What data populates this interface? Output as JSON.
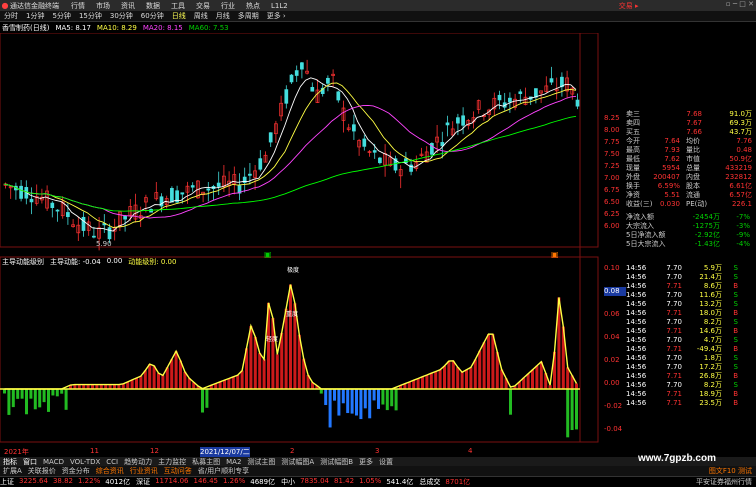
{
  "menubar": {
    "app_title": "通达信金融终端",
    "menus": [
      "行情",
      "市场",
      "资讯",
      "数据",
      "工具",
      "交易",
      "行业",
      "热点",
      "L1L2"
    ],
    "trade_label": "交易 ▸"
  },
  "toolbar": {
    "periods": [
      "分时",
      "1分钟",
      "5分钟",
      "15分钟",
      "30分钟",
      "60分钟",
      "日线",
      "周线",
      "月线",
      "多周期",
      "更多 ›"
    ],
    "active": "日线"
  },
  "ma_line": {
    "title": "香雪制药(日线)",
    "ma5": "MA5: 8.17",
    "ma10": "MA10: 8.29",
    "ma20": "MA20: 8.15",
    "ma60": "MA60: 7.53"
  },
  "price_axis": [
    "8.25",
    "8.00",
    "7.75",
    "7.50",
    "7.25",
    "7.00",
    "6.75",
    "6.50",
    "6.25",
    "6.00"
  ],
  "low_label": "5.90",
  "indicator": {
    "name": "主导动能级别",
    "label1": "主导动能: -0.04",
    "label2": "0.00",
    "label3": "动能级别: 0.00",
    "axis": [
      "0.10",
      "0.08",
      "0.06",
      "0.04",
      "0.02",
      "0.00",
      "-0.02",
      "-0.04"
    ],
    "axis_highlight": "0.08",
    "tags": [
      "轻度",
      "重度",
      "极度"
    ]
  },
  "right_panel": {
    "quotes": [
      {
        "label": "卖三",
        "price": "7.68",
        "vol": "91.0万"
      },
      {
        "label": "卖四",
        "price": "7.67",
        "vol": "69.3万"
      },
      {
        "label": "买五",
        "price": "7.66",
        "vol": "43.7万"
      }
    ],
    "stats": [
      {
        "l1": "今开",
        "v1": "7.64",
        "l2": "均价",
        "v2": "7.76"
      },
      {
        "l1": "最高",
        "v1": "7.93",
        "l2": "量比",
        "v2": "0.48"
      },
      {
        "l1": "最低",
        "v1": "7.62",
        "l2": "市值",
        "v2": "50.9亿"
      },
      {
        "l1": "现量",
        "v1": "5954",
        "l2": "总量",
        "v2": "433219"
      },
      {
        "l1": "外盘",
        "v1": "200407",
        "l2": "内盘",
        "v2": "232812"
      },
      {
        "l1": "换手",
        "v1": "6.59%",
        "l2": "股本",
        "v2": "6.61亿"
      },
      {
        "l1": "净资",
        "v1": "5.51",
        "l2": "流通",
        "v2": "6.57亿"
      },
      {
        "l1": "收益(三)",
        "v1": "0.030",
        "l2": "PE(动)",
        "v2": "226.1"
      }
    ],
    "flows": [
      {
        "label": "净流入额",
        "value": "-2454万",
        "pct": "-7%"
      },
      {
        "label": "大宗流入",
        "value": "-1275万",
        "pct": "-3%"
      },
      {
        "label": "5日净流入额",
        "value": "-2.92亿",
        "pct": "-9%"
      },
      {
        "label": "5日大宗流入",
        "value": "-1.43亿",
        "pct": "-4%"
      }
    ],
    "ticks": [
      {
        "t": "14:56",
        "p": "7.70",
        "v": "5.9万",
        "s": "S"
      },
      {
        "t": "14:56",
        "p": "7.70",
        "v": "21.4万",
        "s": "S"
      },
      {
        "t": "14:56",
        "p": "7.71",
        "v": "8.6万",
        "s": "B"
      },
      {
        "t": "14:56",
        "p": "7.70",
        "v": "11.6万",
        "s": "S"
      },
      {
        "t": "14:56",
        "p": "7.70",
        "v": "13.2万",
        "s": "S"
      },
      {
        "t": "14:56",
        "p": "7.71",
        "v": "18.0万",
        "s": "B"
      },
      {
        "t": "14:56",
        "p": "7.70",
        "v": "8.2万",
        "s": "S"
      },
      {
        "t": "14:56",
        "p": "7.71",
        "v": "14.6万",
        "s": "B"
      },
      {
        "t": "14:56",
        "p": "7.70",
        "v": "4.7万",
        "s": "S"
      },
      {
        "t": "14:56",
        "p": "7.71",
        "v": "-49.4万",
        "s": "B"
      },
      {
        "t": "14:56",
        "p": "7.70",
        "v": "1.8万",
        "s": "S"
      },
      {
        "t": "14:56",
        "p": "7.70",
        "v": "17.2万",
        "s": "S"
      },
      {
        "t": "14:56",
        "p": "7.71",
        "v": "26.8万",
        "s": "B"
      },
      {
        "t": "14:56",
        "p": "7.70",
        "v": "8.2万",
        "s": "S"
      },
      {
        "t": "14:56",
        "p": "7.71",
        "v": "18.9万",
        "s": "B"
      },
      {
        "t": "14:56",
        "p": "7.71",
        "v": "23.5万",
        "s": "B"
      }
    ]
  },
  "date_axis": {
    "labels": [
      "2021年",
      "11",
      "12",
      "2021/12/07/二",
      "2",
      "3",
      "4"
    ]
  },
  "indicator_tabs": [
    "指标",
    "窗口",
    "MACD",
    "VOL-TDX",
    "CCI",
    "趋势动力",
    "主力监控",
    "私募主图",
    "MA2",
    "测试主图",
    "测试幅图A",
    "测试幅图B",
    "更多",
    "设置"
  ],
  "bottom_tabs": [
    "扩展A",
    "关联报价",
    "资金分布",
    "综合资讯",
    "行业资讯",
    "互动问答",
    "省/用户顺利专享"
  ],
  "bottom_right": "图文F10 测试",
  "status": [
    {
      "name": "上证",
      "value": "3225.64",
      "chg": "38.82",
      "pct": "1.22%",
      "vol": "4012亿"
    },
    {
      "name": "深证",
      "value": "11714.06",
      "chg": "146.45",
      "pct": "1.26%",
      "vol": "4689亿"
    },
    {
      "name": "中小",
      "value": "7835.04",
      "chg": "81.42",
      "pct": "1.05%",
      "vol": "541.4亿"
    },
    {
      "name": "总成交",
      "value": "8701亿",
      "chg": "",
      "pct": "",
      "vol": ""
    }
  ],
  "status_right": "平安证券福州行情",
  "watermark": "www.7gpzb.com",
  "colors": {
    "up": "#ff3232",
    "down": "#00d000",
    "ma5": "#ffffff",
    "ma10": "#ffff44",
    "ma20": "#ff44ff",
    "ma60": "#00ff00"
  }
}
